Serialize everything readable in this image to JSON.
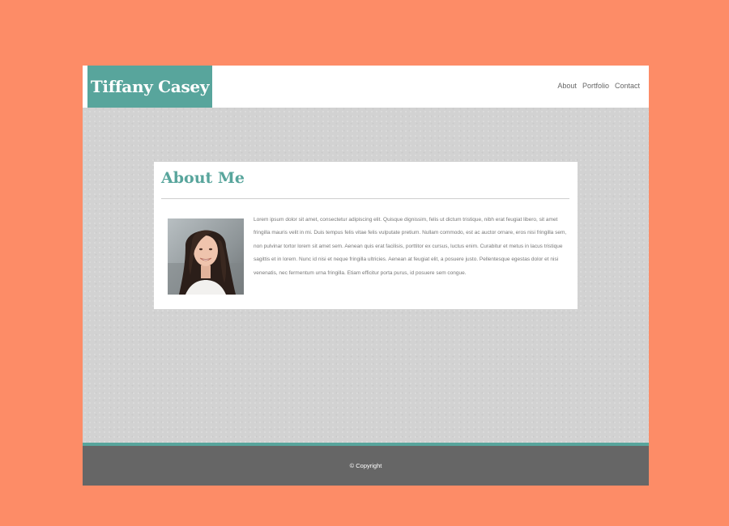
{
  "header": {
    "site_title": "Tiffany Casey",
    "nav": [
      {
        "label": "About"
      },
      {
        "label": "Portfolio"
      },
      {
        "label": "Contact"
      }
    ]
  },
  "about": {
    "title": "About Me",
    "bio": "Lorem ipsum dolor sit amet, consectetur adipiscing elit. Quisque dignissim, felis ut dictum tristique, nibh erat feugiat libero, sit amet fringilla mauris velit in mi. Duis tempus felis vitae felis vulputate pretium. Nullam commodo, est ac auctor ornare, eros nisi fringilla sem, non pulvinar tortor lorem sit amet sem. Aenean quis erat facilisis, porttitor ex cursus, luctus enim. Curabitur et metus in lacus tristique sagittis et in lorem. Nunc id nisi et neque fringilla ultricies. Aenean at feugiat elit, a posuere justo. Pellentesque egestas dolor et nisi venenatis, nec fermentum urna fringilla. Etiam efficitur porta purus, id posuere sem congue."
  },
  "footer": {
    "copyright": "© Copyright"
  },
  "colors": {
    "page_background": "#fd8c67",
    "accent_teal": "#58a59c",
    "footer_background": "#666666",
    "content_background": "#d2d2d2"
  }
}
